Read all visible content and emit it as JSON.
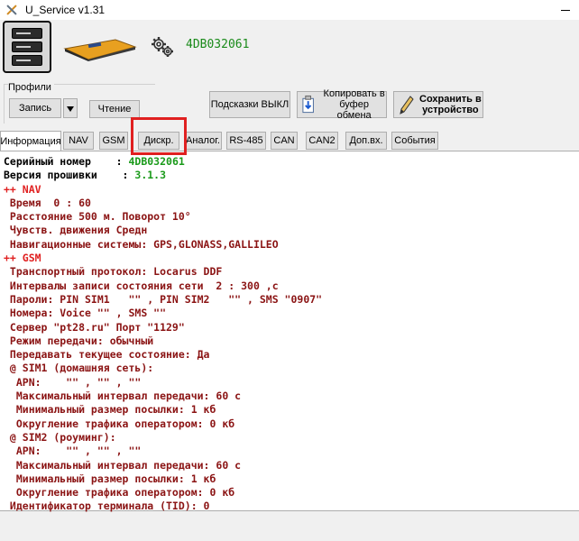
{
  "window": {
    "title": "U_Service v1.31"
  },
  "header": {
    "device_id": "4DB032061"
  },
  "profiles": {
    "label": "Профили",
    "write_label": "Запись",
    "read_label": "Чтение"
  },
  "toolbar": {
    "hints_label": "Подсказки ВЫКЛ",
    "copy_label_1": "Копировать в",
    "copy_label_2": "буфер обмена",
    "save_label_1": "Сохранить в",
    "save_label_2": "устройство"
  },
  "tabs": [
    {
      "label": "Информация",
      "active": true
    },
    {
      "label": "NAV"
    },
    {
      "label": "GSM"
    },
    {
      "label": "Дискр."
    },
    {
      "label": "Аналог."
    },
    {
      "label": "RS-485"
    },
    {
      "label": "CAN"
    },
    {
      "label": "CAN2"
    },
    {
      "label": "Доп.вх."
    },
    {
      "label": "События"
    }
  ],
  "content": {
    "serial_label": "Серийный номер    : ",
    "serial_value": "4DB032061",
    "firmware_label": "Версия прошивки    : ",
    "firmware_value": "3.1.3",
    "lines": [
      {
        "text": "++ NAV",
        "color": "red"
      },
      {
        "text": " Время  0 : 60",
        "color": "darkred"
      },
      {
        "text": " Расстояние 500 м. Поворот 10°",
        "color": "darkred"
      },
      {
        "text": " Чувств. движения Средн",
        "color": "darkred"
      },
      {
        "text": " Навигационные системы: GPS,GLONASS,GALLILEO",
        "color": "darkred"
      },
      {
        "text": "++ GSM",
        "color": "red"
      },
      {
        "text": " Транспортный протокол: Locarus DDF",
        "color": "darkred"
      },
      {
        "text": " Интервалы записи состояния сети  2 : 300 ,с",
        "color": "darkred"
      },
      {
        "text": " Пароли: PIN SIM1   \"\" , PIN SIM2   \"\" , SMS \"0907\"",
        "color": "darkred"
      },
      {
        "text": " Номера: Voice \"\" , SMS \"\"",
        "color": "darkred"
      },
      {
        "text": " Сервер \"pt28.ru\" Порт \"1129\"",
        "color": "darkred"
      },
      {
        "text": " Режим передачи: обычный",
        "color": "darkred"
      },
      {
        "text": " Передавать текущее состояние: Да",
        "color": "darkred"
      },
      {
        "text": " @ SIM1 (домашняя сеть):",
        "color": "darkred"
      },
      {
        "text": "  APN:    \"\" , \"\" , \"\"",
        "color": "darkred"
      },
      {
        "text": "  Максимальный интервал передачи: 60 с",
        "color": "darkred"
      },
      {
        "text": "  Минимальный размер посылки: 1 кб",
        "color": "darkred"
      },
      {
        "text": "  Округление трафика оператором: 0 кб",
        "color": "darkred"
      },
      {
        "text": " @ SIM2 (роуминг):",
        "color": "darkred"
      },
      {
        "text": "  APN:    \"\" , \"\" , \"\"",
        "color": "darkred"
      },
      {
        "text": "  Максимальный интервал передачи: 60 с",
        "color": "darkred"
      },
      {
        "text": "  Минимальный размер посылки: 1 кб",
        "color": "darkred"
      },
      {
        "text": "  Округление трафика оператором: 0 кб",
        "color": "darkred"
      },
      {
        "text": " Идентификатор терминала (TID): 0",
        "color": "darkred"
      }
    ]
  },
  "colors": {
    "green": "#1a9a1a",
    "red": "#e02020",
    "darkred": "#8b1414",
    "highlight": "#e02020"
  }
}
